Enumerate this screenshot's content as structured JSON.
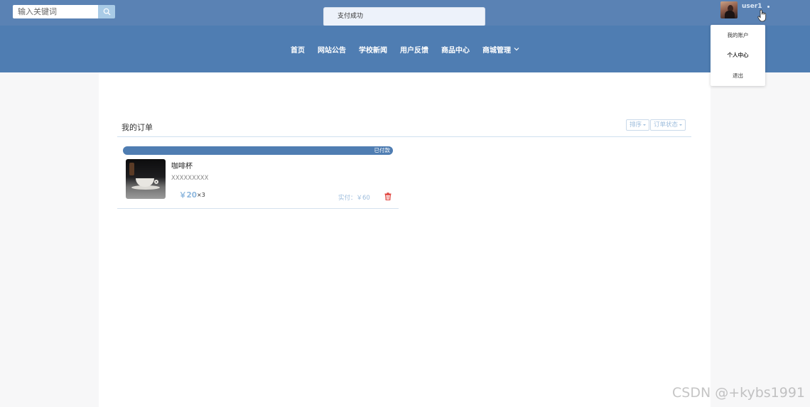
{
  "search": {
    "placeholder": "输入关键词"
  },
  "toast": {
    "text": "支付成功"
  },
  "user": {
    "name": "user1"
  },
  "nav": {
    "items": [
      {
        "label": "首页"
      },
      {
        "label": "网站公告"
      },
      {
        "label": "学校新闻"
      },
      {
        "label": "用户反馈"
      },
      {
        "label": "商品中心"
      },
      {
        "label": "商城管理"
      }
    ]
  },
  "user_menu": {
    "items": [
      {
        "label": "我的账户"
      },
      {
        "label": "个人中心"
      },
      {
        "label": "退出"
      }
    ]
  },
  "orders": {
    "title": "我的订单",
    "sort_label": "排序",
    "status_filter_label": "订单状态",
    "list": [
      {
        "status": "已付款",
        "name": "咖啡杯",
        "desc": "XXXXXXXXX",
        "price": "￥20",
        "qty": "×3",
        "paid": "实付：￥60"
      }
    ]
  },
  "watermark": "CSDN @+kybs1991",
  "colors": {
    "topbar": "#5a82b4",
    "nav": "#4f7db2",
    "accent_light": "#8fb8de",
    "delete": "#e0443e"
  }
}
